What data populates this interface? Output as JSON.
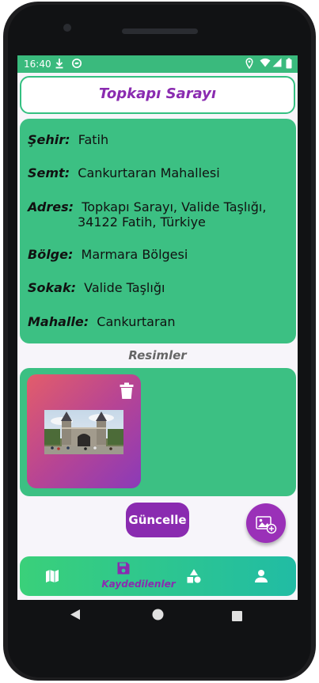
{
  "status": {
    "time": "16:40"
  },
  "place": {
    "title": "Topkapı Sarayı",
    "fields": [
      {
        "label": "Şehir:",
        "value": "Fatih"
      },
      {
        "label": "Semt:",
        "value": "Cankurtaran Mahallesi"
      },
      {
        "label": "Adres:",
        "value": "Topkapı Sarayı, Valide Taşlığı,",
        "value2": "34122 Fatih, Türkiye"
      },
      {
        "label": "Bölge:",
        "value": "Marmara Bölgesi"
      },
      {
        "label": "Sokak:",
        "value": "Valide Taşlığı"
      },
      {
        "label": "Mahalle:",
        "value": "Cankurtaran"
      }
    ]
  },
  "images": {
    "section_title": "Resimler"
  },
  "actions": {
    "update_label": "Güncelle"
  },
  "nav": {
    "active_label": "Kaydedilenler"
  },
  "icons": [
    "download-icon",
    "sync-icon",
    "location-icon",
    "wifi-icon",
    "signal-icon",
    "battery-icon",
    "trash-icon",
    "add-photo-icon",
    "map-icon",
    "save-icon",
    "shapes-icon",
    "person-icon",
    "back-icon",
    "home-icon",
    "recents-icon"
  ],
  "colors": {
    "accent_green": "#3cc083",
    "accent_purple": "#8a2bb0",
    "status_bar": "#3aba7d"
  }
}
